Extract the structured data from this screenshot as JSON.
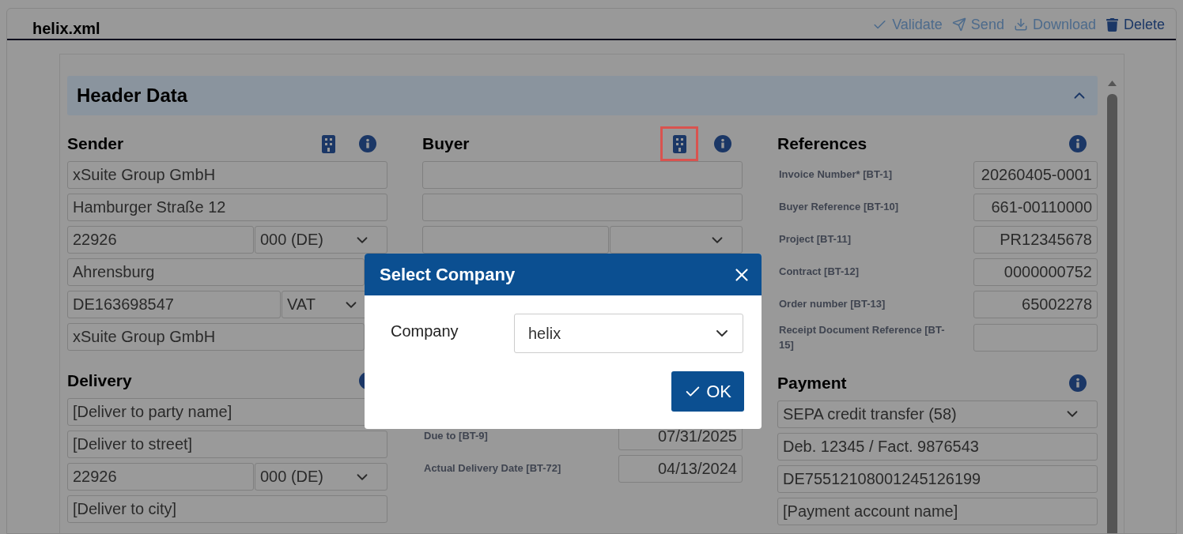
{
  "document": {
    "title": "helix.xml"
  },
  "actions": [
    {
      "kind": "validate",
      "label": "Validate",
      "disabled": true
    },
    {
      "kind": "send",
      "label": "Send",
      "disabled": true
    },
    {
      "kind": "download",
      "label": "Download",
      "disabled": true
    },
    {
      "kind": "delete",
      "label": "Delete",
      "disabled": false
    }
  ],
  "header_section": {
    "title": "Header Data",
    "expanded": true
  },
  "columns": [
    {
      "sections": [
        {
          "title": "Sender",
          "company_button": {
            "highlighted": false
          },
          "info": true,
          "rows": [
            {
              "kind": "text",
              "value": "xSuite Group GmbH"
            },
            {
              "kind": "text",
              "value": "Hamburger Straße 12"
            },
            {
              "kind": "postal",
              "value": "22926",
              "select": "000 (DE)"
            },
            {
              "kind": "text",
              "value": "Ahrensburg"
            },
            {
              "kind": "tax",
              "value": "DE163698547",
              "select": "VAT"
            },
            {
              "kind": "text",
              "value": "xSuite Group GmbH"
            }
          ]
        },
        {
          "title": "Delivery",
          "info": true,
          "rows": [
            {
              "kind": "text",
              "value": "[Deliver to party name]"
            },
            {
              "kind": "text",
              "value": "[Deliver to street]"
            },
            {
              "kind": "postal",
              "value": "22926",
              "select": "000 (DE)"
            },
            {
              "kind": "text",
              "value": "[Deliver to city]"
            }
          ]
        }
      ]
    },
    {
      "sections": [
        {
          "title": "Buyer",
          "company_button": {
            "highlighted": true
          },
          "info": true,
          "rows": [
            {
              "kind": "text"
            },
            {
              "kind": "text"
            },
            {
              "kind": "postal"
            }
          ]
        },
        {
          "info": false,
          "rows": [
            {
              "kind": "labeled",
              "label": "Due to [BT-9]",
              "value": "07/31/2025"
            },
            {
              "kind": "labeled",
              "label": "Actual Delivery Date [BT-72]",
              "value": "04/13/2024"
            }
          ]
        }
      ]
    },
    {
      "sections": [
        {
          "title": "References",
          "info": true,
          "rows": [
            {
              "kind": "labeled",
              "label": "Invoice Number* [BT-1]",
              "value": "20260405-0001"
            },
            {
              "kind": "labeled",
              "label": "Buyer Reference [BT-10]",
              "value": "661-00110000"
            },
            {
              "kind": "labeled",
              "label": "Project [BT-11]",
              "value": "PR12345678"
            },
            {
              "kind": "labeled",
              "label": "Contract [BT-12]",
              "value": "0000000752"
            },
            {
              "kind": "labeled",
              "label": "Order number [BT-13]",
              "value": "65002278"
            },
            {
              "kind": "labeled",
              "label": "Receipt Document Reference [BT-15]"
            }
          ]
        },
        {
          "title": "Payment",
          "info": true,
          "rows": [
            {
              "kind": "select",
              "value": "SEPA credit transfer (58)"
            },
            {
              "kind": "text",
              "value": "Deb. 12345 / Fact. 9876543"
            },
            {
              "kind": "text",
              "value": "DE75512108001245126199"
            },
            {
              "kind": "text",
              "value": "[Payment account name]"
            }
          ]
        }
      ]
    }
  ],
  "dialog": {
    "title": "Select Company",
    "field_label": "Company",
    "value": "helix",
    "ok": "OK"
  }
}
